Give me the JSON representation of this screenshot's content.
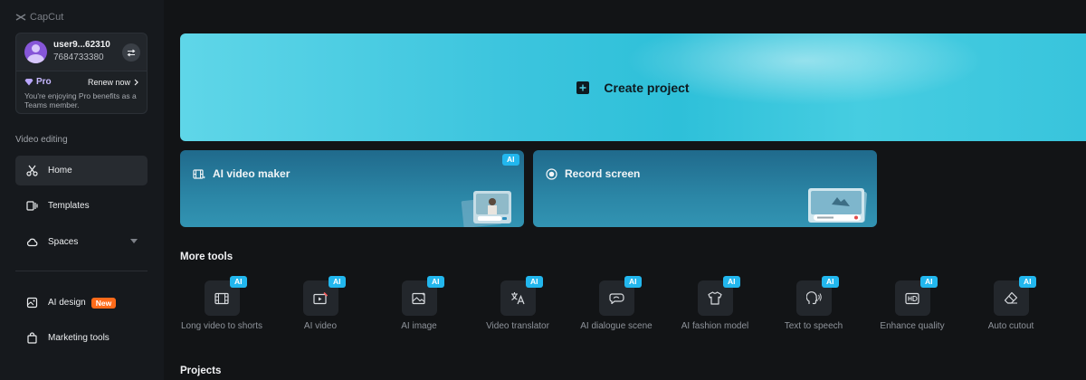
{
  "app": {
    "name": "CapCut"
  },
  "account": {
    "username": "user9...62310",
    "user_id": "7684733380",
    "pro_label": "Pro",
    "renew_label": "Renew now",
    "pro_description": "You're enjoying Pro benefits as a Teams member."
  },
  "sidebar": {
    "section_label": "Video editing",
    "items": [
      {
        "label": "Home",
        "icon": "scissors-icon",
        "active": true
      },
      {
        "label": "Templates",
        "icon": "templates-icon",
        "active": false
      },
      {
        "label": "Spaces",
        "icon": "cloud-icon",
        "active": false
      }
    ],
    "ai_design": {
      "label": "AI design",
      "badge": "New",
      "icon": "ai-design-icon"
    },
    "marketing": {
      "label": "Marketing tools",
      "icon": "bag-icon"
    }
  },
  "main": {
    "create_project_label": "Create project",
    "cards": [
      {
        "label": "AI video maker",
        "badge": "AI",
        "icon": "film-sparkle-icon"
      },
      {
        "label": "Record screen",
        "badge": "",
        "icon": "record-icon"
      }
    ],
    "more_tools_title": "More tools",
    "tools": [
      {
        "label": "Long video to shorts",
        "badge": "AI",
        "icon": "long-video-icon"
      },
      {
        "label": "AI video",
        "badge": "AI",
        "icon": "ai-video-icon"
      },
      {
        "label": "AI image",
        "badge": "AI",
        "icon": "image-icon"
      },
      {
        "label": "Video translator",
        "badge": "AI",
        "icon": "translate-icon"
      },
      {
        "label": "AI dialogue scene",
        "badge": "AI",
        "icon": "dialogue-icon"
      },
      {
        "label": "AI fashion model",
        "badge": "AI",
        "icon": "shirt-icon"
      },
      {
        "label": "Text to speech",
        "badge": "AI",
        "icon": "speech-icon"
      },
      {
        "label": "Enhance quality",
        "badge": "AI",
        "icon": "hd-icon"
      },
      {
        "label": "Auto cutout",
        "badge": "AI",
        "icon": "eraser-icon"
      }
    ],
    "projects_title": "Projects"
  },
  "colors": {
    "background": "#121416",
    "sidebar": "#16191d",
    "accent_cyan": "#3dc5de",
    "ai_badge": "#22b7ee",
    "new_badge": "#ff6b1a",
    "pro": "#c6b8ff"
  }
}
